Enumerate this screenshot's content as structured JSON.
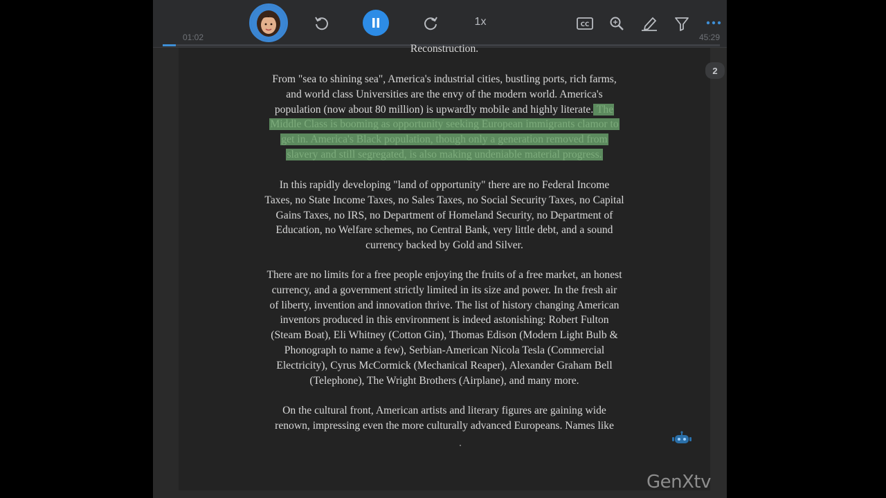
{
  "player": {
    "elapsed": "01:02",
    "total": "45:29",
    "speed": "1x",
    "progress_fraction": 0.023,
    "accent_color": "#2d8ce6",
    "icons": [
      "avatar",
      "rewind-icon",
      "pause-icon",
      "forward-icon",
      "cc-icon",
      "search-icon",
      "highlighter-icon",
      "filter-icon",
      "more-icon"
    ]
  },
  "reader": {
    "page_badge": "2",
    "reconstruction": "Reconstruction.",
    "para1": [
      "From \"sea to shining sea\", America's industrial cities, bustling ports, rich farms,",
      "and world class Universities are the envy of the modern world. America's",
      "population (now about 80 million) is upwardly mobile and highly literate."
    ],
    "para1_hl": [
      " The",
      "Middle Class is booming as opportunity seeking European immigrants clamor to",
      "get in. America's Black population, though only a generation removed from",
      "slavery and still segregated, is also making undeniable material progress."
    ],
    "para2": [
      "In this rapidly developing \"land of opportunity\" there are no Federal Income",
      "Taxes, no State Income Taxes, no Sales Taxes, no Social Security Taxes, no Capital",
      "Gains Taxes, no IRS, no Department of Homeland Security, no Department of",
      "Education, no Welfare schemes, no Central Bank, very little debt, and a sound",
      "currency backed by Gold and Silver."
    ],
    "para3": [
      "There are no limits for a free people enjoying the fruits of a free market, an honest",
      "currency, and a government strictly limited in its size and power. In the fresh air",
      "of liberty, invention and innovation thrive. The list of history changing American",
      "inventors produced in this environment is indeed astonishing: Robert Fulton",
      "(Steam Boat), Eli Whitney (Cotton Gin), Thomas Edison (Modern Light Bulb &",
      "Phonograph to name a few), Serbian-American Nicola Tesla (Commercial",
      "Electricity), Cyrus McCormick (Mechanical Reaper), Alexander Graham Bell",
      "(Telephone), The Wright Brothers (Airplane), and many more."
    ],
    "para4": [
      "On the cultural front, American artists and literary figures are gaining wide",
      "renown, impressing even the more culturally advanced Europeans. Names like"
    ],
    "highlight_color": "#5c8a5e"
  },
  "watermark": "GenXtv"
}
